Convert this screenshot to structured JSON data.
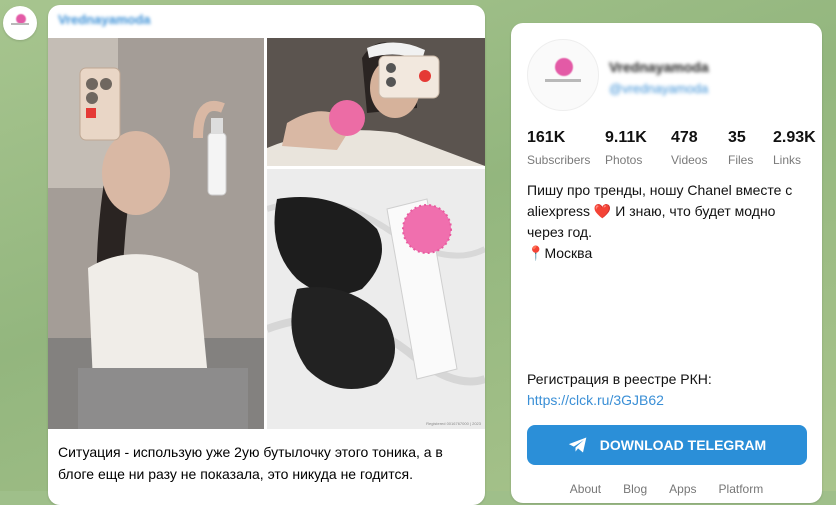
{
  "post": {
    "author": "Vrednayamoda",
    "text": "Ситуация - использую уже 2ую бутылочку этого тоника, а в блоге еще ни разу не показала, это никуда не годится.",
    "photo_caption": "Registered 0016767000 | 2023"
  },
  "channel": {
    "title": "Vrednayamoda",
    "username": "@vrednayamoda",
    "stats": [
      {
        "value": "161K",
        "label": "Subscribers"
      },
      {
        "value": "9.11K",
        "label": "Photos"
      },
      {
        "value": "478",
        "label": "Videos"
      },
      {
        "value": "35",
        "label": "Files"
      },
      {
        "value": "2.93K",
        "label": "Links"
      }
    ],
    "description_line1": "Пишу про тренды, ношу Chanel вместе с aliexpress",
    "description_line2": "И знаю, что будет модно через год.",
    "location": "Москва",
    "registry_label": "Регистрация в реестре РКН:",
    "registry_link": "https://clck.ru/3GJB62",
    "download_label": "DOWNLOAD TELEGRAM",
    "footer_links": [
      "About",
      "Blog",
      "Apps",
      "Platform"
    ]
  },
  "colors": {
    "accent": "#2b8fd8",
    "link": "#3a8fd6",
    "background": "#9fbf8a"
  },
  "icons": {
    "heart": "red-heart-icon",
    "pin": "location-pin-icon",
    "telegram": "telegram-plane-icon"
  }
}
